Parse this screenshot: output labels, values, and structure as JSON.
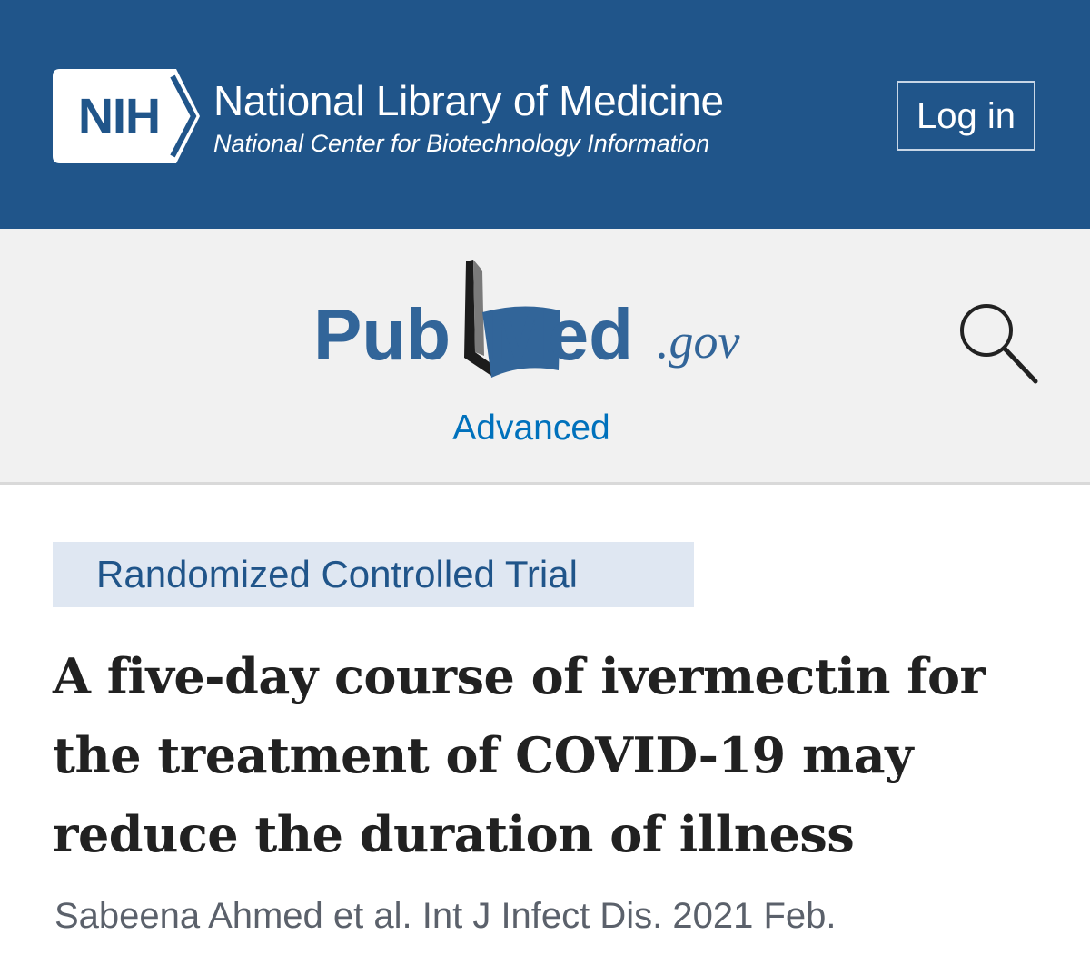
{
  "header": {
    "nih_badge": "NIH",
    "library_title": "National Library of Medicine",
    "library_subtitle": "National Center for Biotechnology Information",
    "login_label": "Log in"
  },
  "pubmed": {
    "logo_pub": "Pub",
    "logo_med": "Med",
    "logo_domain": ".gov",
    "advanced_label": "Advanced"
  },
  "article": {
    "type": "Randomized Controlled Trial",
    "title": "A five-day course of ivermectin for the treatment of COVID-19 may reduce the duration of illness",
    "citation": "Sabeena Ahmed et al. Int J Infect Dis. 2021 Feb."
  },
  "icons": {
    "search": "search-icon",
    "book": "open-book-icon",
    "nih_chevron": "chevron-right-icon"
  },
  "colors": {
    "nih_blue": "#20558a",
    "link_blue": "#0071bc",
    "badge_bg": "#dfe7f2",
    "bar_bg": "#f1f1f1",
    "title_text": "#212121",
    "citation_text": "#5b616b"
  }
}
